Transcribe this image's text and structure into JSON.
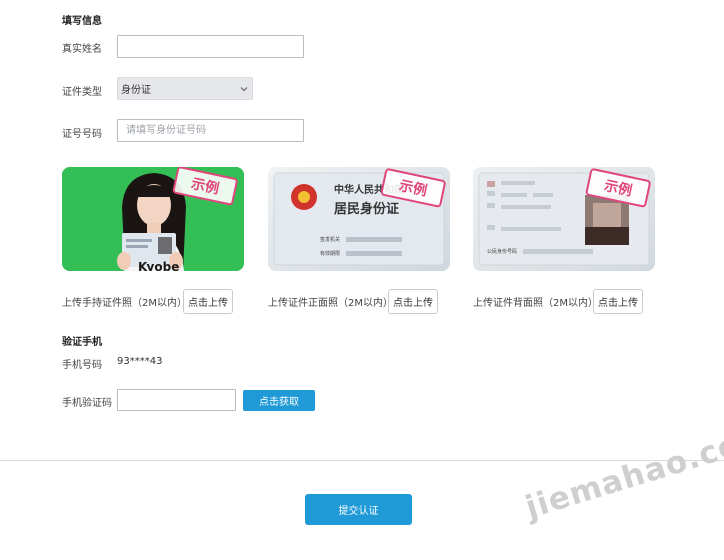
{
  "form": {
    "section_title": "填写信息",
    "real_name_label": "真实姓名",
    "real_name_value": "",
    "id_type_label": "证件类型",
    "id_type_selected": "身份证",
    "id_number_label": "证号号码",
    "id_number_placeholder": "请填写身份证号码",
    "id_number_value": ""
  },
  "uploads": [
    {
      "text": "上传手持证件照（2M以内）",
      "button": "点击上传",
      "sample_badge": "示例",
      "photo_caption": "Kyobe"
    },
    {
      "text": "上传证件正面照（2M以内）",
      "button": "点击上传",
      "sample_badge": "示例",
      "card_title": "中华人民共和国",
      "card_subtitle": "居民身份证",
      "issuer_label": "签发机关",
      "validity_label": "有效期限"
    },
    {
      "text": "上传证件背面照（2M以内）",
      "button": "点击上传",
      "sample_badge": "示例",
      "id_number_label": "公民身份号码"
    }
  ],
  "phone": {
    "section_title": "验证手机",
    "phone_label": "手机号码",
    "phone_value": "93****43",
    "code_label": "手机验证码",
    "code_value": "",
    "get_code_button": "点击获取"
  },
  "submit_button": "提交认证",
  "watermark_text": "jiemahao.com",
  "colors": {
    "accent": "#1f9ad6",
    "sample_badge": "#e0457b",
    "green_screen": "#2fbf54"
  }
}
